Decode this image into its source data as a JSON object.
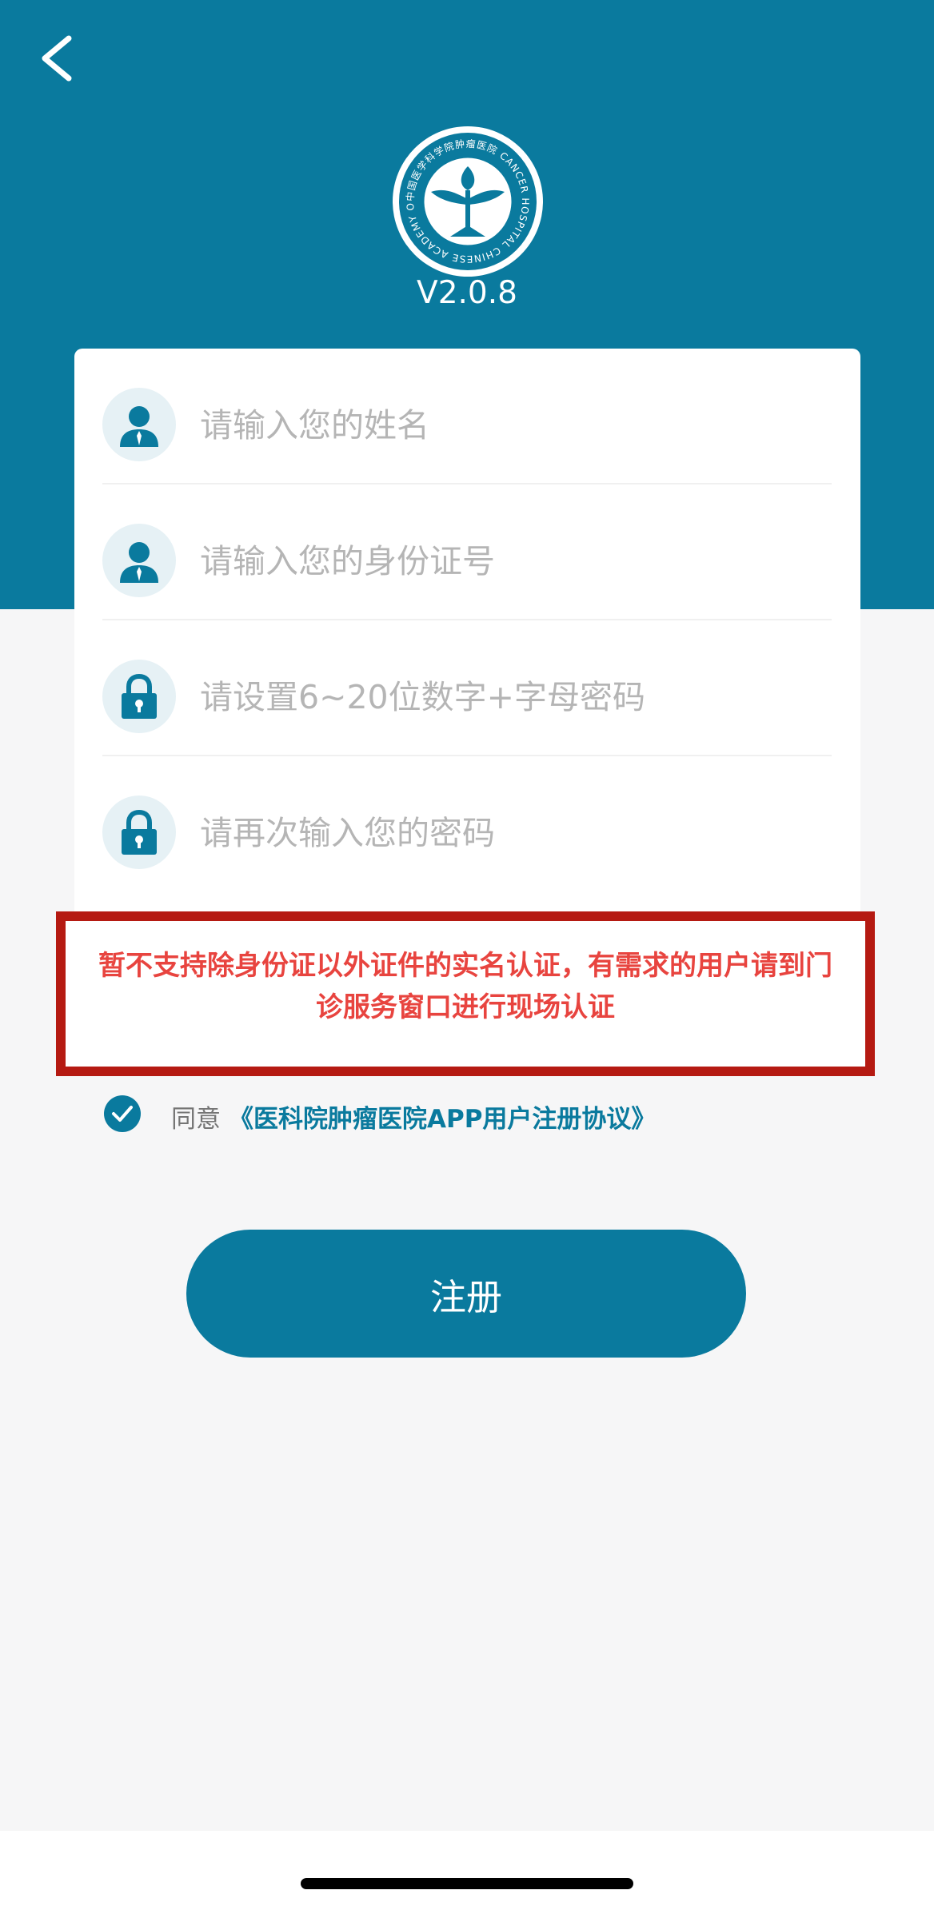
{
  "header": {
    "back_icon": "chevron-left-icon",
    "logo_icon": "hospital-emblem",
    "logo_ring_text": "中国医学科学院肿瘤医院 CANCER HOSPITAL CHINESE ACADEMY OF MEDICAL SCIENCES",
    "version": "V2.0.8",
    "background_color": "#0a7a9e"
  },
  "form": {
    "fields": [
      {
        "icon": "person-icon",
        "placeholder": "请输入您的姓名",
        "value": ""
      },
      {
        "icon": "person-icon",
        "placeholder": "请输入您的身份证号",
        "value": ""
      },
      {
        "icon": "lock-icon",
        "placeholder": "请设置6~20位数字+字母密码",
        "value": ""
      },
      {
        "icon": "lock-icon",
        "placeholder": "请再次输入您的密码",
        "value": ""
      }
    ]
  },
  "notice": {
    "text": "暂不支持除身份证以外证件的实名认证，有需求的用户请到门诊服务窗口进行现场认证",
    "border_color": "#b51a12",
    "text_color": "#e8443f"
  },
  "agreement": {
    "checked": true,
    "prefix": "同意",
    "link_text": "《医科院肿瘤医院APP用户注册协议》"
  },
  "register": {
    "label": "注册"
  }
}
